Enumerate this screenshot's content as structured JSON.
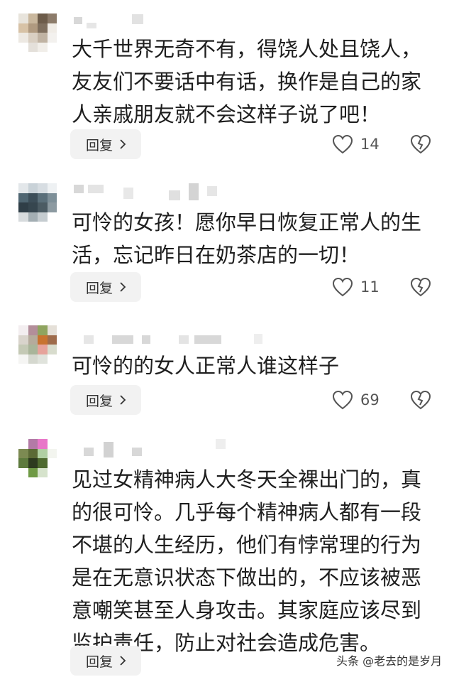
{
  "comments": [
    {
      "text": "大千世界无奇不有，得饶人处且饶人，友友们不要话中有话，换作是自己的家人亲戚朋友就不会这样子说了吧！",
      "reply_label": "回复",
      "likes": "14",
      "avatar_colors": [
        "#e8e4dc",
        "#c9b79d",
        "#6d5c4a",
        "#8c7b6a",
        "#d7c2a6",
        "#b09a80",
        "#7f6f5e",
        "#f0ece6",
        "#ede9e3",
        "#d9cfc2",
        "#c0b3a3",
        "#f3f1ee",
        "#ffffff",
        "#e4e0da",
        "#f1eee9",
        "#ffffff"
      ]
    },
    {
      "text": "可怜的女孩！愿你早日恢复正常人的生活，忘记昨日在奶茶店的一切！",
      "reply_label": "回复",
      "likes": "11",
      "avatar_colors": [
        "#e3e7ea",
        "#c9d2d8",
        "#d7dde2",
        "#eef1f3",
        "#4f6672",
        "#3c4e59",
        "#5a6f7a",
        "#7d8f98",
        "#2f3e47",
        "#36464f",
        "#4b5b63",
        "#8c9aa1",
        "#d7dbdd",
        "#a3aeb3",
        "#c5ccd0",
        "#ffffff"
      ]
    },
    {
      "text": "可怜的的女人正常人谁这样子",
      "reply_label": "回复",
      "likes": "69",
      "avatar_colors": [
        "#f3eef0",
        "#b38e9a",
        "#8fa45f",
        "#e5e0d8",
        "#d9d4cc",
        "#b5ab9c",
        "#c8732f",
        "#9e6b4b",
        "#c4c9b5",
        "#a9b59a",
        "#e6a39b",
        "#d8dccd",
        "#f5f5f3",
        "#d5d8cf",
        "#e0e3dc",
        "#ffffff"
      ]
    },
    {
      "text": "见过女精神病人大冬天全裸出门的，真的很可怜。几乎每个精神病人都有一段不堪的人生经历，他们有悖常理的行为是在无意识状态下做出的，不应该被恶意嘲笑甚至人身攻击。其家庭应该尽到监护责任，防止对社会造成危害。",
      "reply_label": "回复",
      "likes": "",
      "avatar_colors": [
        "#ffffff",
        "#b37aa6",
        "#e877c8",
        "#ffffff",
        "#7c8a52",
        "#5b6a36",
        "#b0cfa3",
        "#f3f5ef",
        "#5d7a3d",
        "#2d3a1f",
        "#4e6a2f",
        "#ffffff",
        "#ffffff",
        "#6f9a45",
        "#d6e3cc",
        "#ffffff"
      ]
    }
  ],
  "watermark": "头条 @老去的是岁月",
  "icons": {
    "like": "heart-outline-icon",
    "dislike": "broken-heart-icon",
    "reply_chevron": "chevron-right-icon"
  }
}
